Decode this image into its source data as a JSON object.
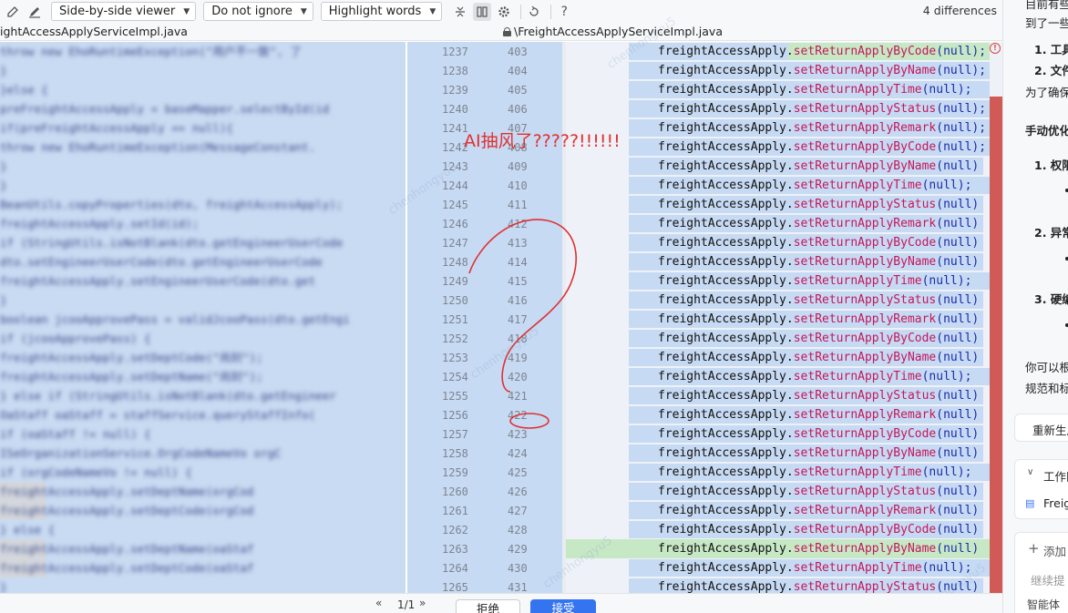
{
  "toolbar": {
    "viewer_mode": "Side-by-side viewer",
    "whitespace_mode": "Do not ignore",
    "highlight_mode": "Highlight words",
    "differences": "4 differences",
    "icons": [
      "edit-icon",
      "pencil-icon",
      "collapse-unchanged-icon",
      "sync-scroll-icon",
      "settings-icon",
      "history-icon",
      "help-icon"
    ]
  },
  "files": {
    "left": "ightAccessApplyServiceImpl.java",
    "right": "\\FreightAccessApplyServiceImpl.java"
  },
  "left_code": [
    {
      "t": "            throw new EhoRuntimeException(\"用户不一致\", 了"
    },
    {
      "t": "        }"
    },
    {
      "t": "    }else {"
    },
    {
      "t": "        preFreightAccessApply = baseMapper.selectById(id"
    },
    {
      "t": "        if(preFreightAccessApply == null){"
    },
    {
      "t": "            throw new EhoRuntimeException(MessageConstant."
    },
    {
      "t": "        }"
    },
    {
      "t": "    }"
    },
    {
      "t": "    BeanUtils.copyProperties(dto, freightAccessApply);"
    },
    {
      "t": "    freightAccessApply.setId(id);"
    },
    {
      "t": "    if (StringUtils.isNotBlank(dto.getEngineerUserCode"
    },
    {
      "t": "        dto.setEngineerUserCode(dto.getEngineerUserCode"
    },
    {
      "t": "        freightAccessApply.setEngineerUserCode(dto.get"
    },
    {
      "t": "    }"
    },
    {
      "t": "    boolean jcooApprovePass = validJcooPass(dto.getEngi"
    },
    {
      "t": "    if (jcooApprovePass) {"
    },
    {
      "t": "        freightAccessApply.setDeptCode(\"尚封\");"
    },
    {
      "t": "        freightAccessApply.setDeptName(\"尚封\");"
    },
    {
      "t": "    } else if (StringUtils.isNotBlank(dto.getEngineer"
    },
    {
      "t": "        OaStaff oaStaff = staffService.queryStaffInfo("
    },
    {
      "t": "        if (oaStaff != null) {"
    },
    {
      "t": "            ISeOrganizationService.OrgCodeNameVo orgC"
    },
    {
      "t": "            if (orgCodeNameVo != null) {"
    },
    {
      "t": "                freightAccessApply.setDeptName(orgCod"
    },
    {
      "t": "                freightAccessApply.setDeptCode(orgCod"
    },
    {
      "t": "            } else {"
    },
    {
      "t": "                freightAccessApply.setDeptName(oaStaf"
    },
    {
      "t": "                freightAccessApply.setDeptCode(oaStaf"
    },
    {
      "t": "        }"
    }
  ],
  "gutter": [
    {
      "a": "1237",
      "b": "403"
    },
    {
      "a": "1238",
      "b": "404"
    },
    {
      "a": "1239",
      "b": "405"
    },
    {
      "a": "1240",
      "b": "406"
    },
    {
      "a": "1241",
      "b": "407"
    },
    {
      "a": "1242",
      "b": "408"
    },
    {
      "a": "1243",
      "b": "409"
    },
    {
      "a": "1244",
      "b": "410"
    },
    {
      "a": "1245",
      "b": "411"
    },
    {
      "a": "1246",
      "b": "412"
    },
    {
      "a": "1247",
      "b": "413"
    },
    {
      "a": "1248",
      "b": "414"
    },
    {
      "a": "1249",
      "b": "415"
    },
    {
      "a": "1250",
      "b": "416"
    },
    {
      "a": "1251",
      "b": "417"
    },
    {
      "a": "1252",
      "b": "418"
    },
    {
      "a": "1253",
      "b": "419"
    },
    {
      "a": "1254",
      "b": "420"
    },
    {
      "a": "1255",
      "b": "421"
    },
    {
      "a": "1256",
      "b": "422"
    },
    {
      "a": "1257",
      "b": "423"
    },
    {
      "a": "1258",
      "b": "424"
    },
    {
      "a": "1259",
      "b": "425"
    },
    {
      "a": "1260",
      "b": "426"
    },
    {
      "a": "1261",
      "b": "427"
    },
    {
      "a": "1262",
      "b": "428"
    },
    {
      "a": "1263",
      "b": "429"
    },
    {
      "a": "1264",
      "b": "430"
    },
    {
      "a": "1265",
      "b": "431"
    }
  ],
  "right_code": [
    {
      "obj": "freightAccessApply.",
      "meth": "setReturnApplyByCode",
      "arg": "(null);"
    },
    {
      "obj": "freightAccessApply.",
      "meth": "setReturnApplyByName",
      "arg": "(null);"
    },
    {
      "obj": "freightAccessApply.",
      "meth": "setReturnApplyTime",
      "arg": "(null);"
    },
    {
      "obj": "freightAccessApply.",
      "meth": "setReturnApplyStatus",
      "arg": "(null);"
    },
    {
      "obj": "freightAccessApply.",
      "meth": "setReturnApplyRemark",
      "arg": "(null);"
    },
    {
      "obj": "freightAccessApply.",
      "meth": "setReturnApplyByCode",
      "arg": "(null);"
    },
    {
      "obj": "freightAccessApply.",
      "meth": "setReturnApplyByName",
      "arg": "(null)"
    },
    {
      "obj": "freightAccessApply.",
      "meth": "setReturnApplyTime",
      "arg": "(null);"
    },
    {
      "obj": "freightAccessApply.",
      "meth": "setReturnApplyStatus",
      "arg": "(null)"
    },
    {
      "obj": "freightAccessApply.",
      "meth": "setReturnApplyRemark",
      "arg": "(null)"
    },
    {
      "obj": "freightAccessApply.",
      "meth": "setReturnApplyByCode",
      "arg": "(null)"
    },
    {
      "obj": "freightAccessApply.",
      "meth": "setReturnApplyByName",
      "arg": "(null)"
    },
    {
      "obj": "freightAccessApply.",
      "meth": "setReturnApplyTime",
      "arg": "(null);"
    },
    {
      "obj": "freightAccessApply.",
      "meth": "setReturnApplyStatus",
      "arg": "(null)"
    },
    {
      "obj": "freightAccessApply.",
      "meth": "setReturnApplyRemark",
      "arg": "(null)"
    },
    {
      "obj": "freightAccessApply.",
      "meth": "setReturnApplyByCode",
      "arg": "(null)"
    },
    {
      "obj": "freightAccessApply.",
      "meth": "setReturnApplyByName",
      "arg": "(null)"
    },
    {
      "obj": "freightAccessApply.",
      "meth": "setReturnApplyTime",
      "arg": "(null);"
    },
    {
      "obj": "freightAccessApply.",
      "meth": "setReturnApplyStatus",
      "arg": "(null)"
    },
    {
      "obj": "freightAccessApply.",
      "meth": "setReturnApplyRemark",
      "arg": "(null)"
    },
    {
      "obj": "freightAccessApply.",
      "meth": "setReturnApplyByCode",
      "arg": "(null)"
    },
    {
      "obj": "freightAccessApply.",
      "meth": "setReturnApplyByName",
      "arg": "(null)"
    },
    {
      "obj": "freightAccessApply.",
      "meth": "setReturnApplyTime",
      "arg": "(null);"
    },
    {
      "obj": "freightAccessApply.",
      "meth": "setReturnApplyStatus",
      "arg": "(null)"
    },
    {
      "obj": "freightAccessApply.",
      "meth": "setReturnApplyRemark",
      "arg": "(null)"
    },
    {
      "obj": "freightAccessApply.",
      "meth": "setReturnApplyByCode",
      "arg": "(null)"
    },
    {
      "obj": "freightAccessApply.",
      "meth": "setReturnApplyByName",
      "arg": "(null)"
    },
    {
      "obj": "freightAccessApply.",
      "meth": "setReturnApplyTime",
      "arg": "(null);"
    },
    {
      "obj": "freightAccessApply.",
      "meth": "setReturnApplyStatus",
      "arg": "(null)"
    }
  ],
  "annotation": {
    "text": "AI抽风了?????!!!!!!",
    "color": "#e03030"
  },
  "bottom": {
    "page": "1/1",
    "reject": "拒绝",
    "accept": "接受"
  },
  "sidebar": {
    "line1": "目前有些",
    "line2": "到了一些",
    "item1": "1. 工具",
    "item2": "2. 文件",
    "line3": "为了确保",
    "heading": "手动优化",
    "sub1": "1. 权限",
    "sub2": "2. 异常",
    "sub3": "3. 硬编",
    "line4": "你可以根",
    "line5": "规范和标",
    "regen": "重新生成",
    "workarea": "工作区",
    "file": "Freig",
    "add": "添加",
    "input_placeholder": "继续提",
    "mode": "智能体"
  },
  "watermark": "chenhongyu5",
  "colors": {
    "removed_bg": "#c7daf3",
    "added_bg": "#c7e8c5",
    "accept_btn": "#3574f0",
    "scroll_marker": "#d05a56"
  }
}
